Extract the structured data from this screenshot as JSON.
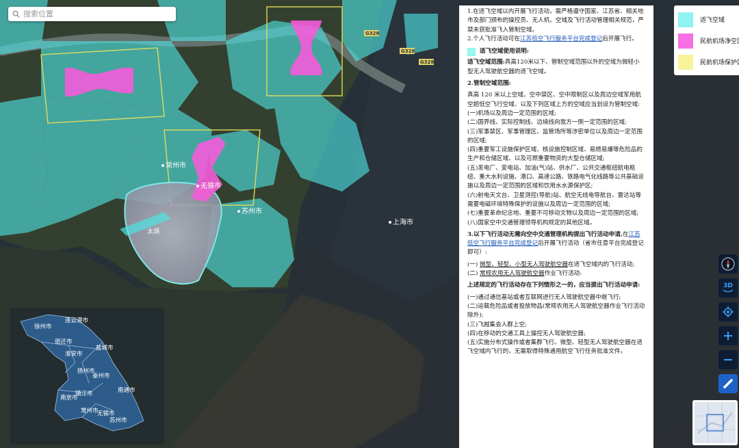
{
  "search": {
    "placeholder": "搜索位置"
  },
  "map": {
    "city_labels": [
      {
        "text": "苏州市"
      },
      {
        "text": "无锡市"
      },
      {
        "text": "上海市"
      },
      {
        "text": "常州市"
      },
      {
        "text": "太湖"
      }
    ],
    "road_badges": [
      "G328",
      "G328",
      "G328"
    ],
    "colors": {
      "suitable_airspace": "#4fe3e3",
      "clearance_zone": "#f55bd9",
      "protection_zone": "#e6e05a"
    }
  },
  "inset_map": {
    "cities": [
      "连云港市",
      "徐州市",
      "宿迁市",
      "淮安市",
      "盐城市",
      "扬州市",
      "泰州市",
      "镇江市",
      "南京市",
      "南通市",
      "常州市",
      "无锡市",
      "苏州市"
    ]
  },
  "panel": {
    "p1": "1.在适飞空域以内开展飞行活动，需严格遵守国家、江苏省、相关地市及部门颁布的操控员、无人机、空域及飞行活动管理相关规范，严禁未获批准飞入管制空域。",
    "p2_pre": "2.个人飞行活动可在",
    "p2_link": "江苏低空飞行服务平台完成登记",
    "p2_post": "后开展飞行。",
    "usage_title": "适飞空域使用说明:",
    "range_title": "适飞空域范围:",
    "range_text": "真高120米以下、管制空域范围以外的空域为微轻小型无人驾驶航空器的适飞空域。",
    "ctrl_title": "2.管制空域范围:",
    "ctrl_text": "真高 120 米以上空域、空中禁区、空中限制区以及周边空域军用航空超低空飞行空域、以及下列区域上方的空域应当划设为管制空域:",
    "ctrl_items": [
      "(一)机场以及周边一定范围的区域;",
      "(二)国界线、实际控制线、边境线向我方一侧一定范围的区域;",
      "(三)军事禁区、军事管理区、监管场所等涉密单位以及周边一定范围的区域;",
      "(四)重要军工设施保护区域、核设施控制区域、易燃易爆等危险品的生产和仓储区域、以及可燃重要物资的大型仓储区域;",
      "(五)发电厂、变电站、加油(气)站、供水厂、公共交通枢纽航电枢纽、重大水利设施、港口、高速公路、铁路电气化线路等公共基础设施以及周边一定范围的区域和饮用水水源保护区;",
      "(六)射电天文台、卫星测控(导航)站、航空无线电导航台、雷达站等需要电磁环境特殊保护的设施以及周边一定范围的区域;",
      "(七)重要革命纪念地、重要不可移动文物以及周边一定范围的区域;",
      "(八)国家空中交通管理领导机构规定的其他区域。"
    ],
    "p3_title": "3.以下飞行活动无需向空中交通管理机构提出飞行活动申请,",
    "p3_pre": "在",
    "p3_link": "江苏低空飞行服务平台完成登记",
    "p3_post": "后开展飞行活动（省市任意平台完成登记即可）:",
    "p3_item1_pre": "(一) ",
    "p3_item1_u": "微型、轻型、小型无人驾驶航空器",
    "p3_item1_post": "在适飞空域内的飞行活动;",
    "p3_item2_pre": "(二) ",
    "p3_item2_u": "常规农用无人驾驶航空器",
    "p3_item2_post": "作业飞行活动:",
    "p4_title": "上述规定的飞行活动存在下列情形之一的，应当提出飞行活动申请:",
    "p4_items": [
      "(一)通过通信基站或者互联网进行无人驾驶航空器中继飞行;",
      "(二)运载危险品或者投放物品(常规农用无人驾驶航空器作业飞行活动除外);",
      "(三)飞越集会人群上空;",
      "(四)在移动的交通工具上操控无人驾驶航空器;",
      "(五)实施分布式操作或者集群飞行。微型、轻型无人驾驶航空器在适飞空域内飞行的，无需取得特殊通用航空飞行任务批准文件。"
    ]
  },
  "legend": [
    {
      "label": "适飞空域",
      "color": "#8ff3f3"
    },
    {
      "label": "民航机场净空区",
      "color": "#f86fe3"
    },
    {
      "label": "民航机场保护区",
      "color": "#f7f39a"
    }
  ],
  "controls": {
    "three_d_label": "3D"
  }
}
